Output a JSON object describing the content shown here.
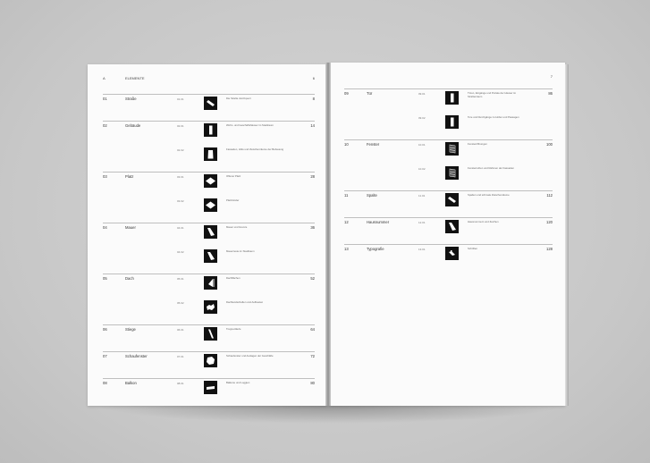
{
  "left_page": {
    "header": {
      "letter": "A",
      "title": "ELEMENTE",
      "page": "6"
    },
    "entries": [
      {
        "num": "01",
        "title": "Straße",
        "page": "8",
        "subs": [
          {
            "code": "01.01",
            "desc": "Die Straße durchquert",
            "icon": "diagonal-bar-icon"
          }
        ]
      },
      {
        "num": "02",
        "title": "Gebäude",
        "page": "14",
        "subs": [
          {
            "code": "02.01",
            "desc": "Wohn- und Geschäftshäuser im Stadtraum",
            "icon": "vertical-block-icon"
          },
          {
            "code": "02.02",
            "desc": "Fassaden, Höfe und Zwischenräume der Bebauung",
            "icon": "tall-block-icon"
          }
        ]
      },
      {
        "num": "03",
        "title": "Platz",
        "page": "28",
        "subs": [
          {
            "code": "03.01",
            "desc": "Offener Platz",
            "icon": "diamond-icon"
          },
          {
            "code": "03.02",
            "desc": "Platzränder",
            "icon": "diamond-icon"
          }
        ]
      },
      {
        "num": "04",
        "title": "Mauer",
        "page": "36",
        "subs": [
          {
            "code": "04.01",
            "desc": "Mauer und Grenze",
            "icon": "wedge-icon"
          },
          {
            "code": "04.02",
            "desc": "Mauerreste im Stadtraum",
            "icon": "wedge-icon"
          }
        ]
      },
      {
        "num": "05",
        "title": "Dach",
        "page": "52",
        "subs": [
          {
            "code": "05.01",
            "desc": "Dachflächen",
            "icon": "triangle-icon"
          },
          {
            "code": "05.02",
            "desc": "Dachlandschaften und Aufbauten",
            "icon": "splash-icon"
          }
        ]
      },
      {
        "num": "06",
        "title": "Stiege",
        "page": "64",
        "subs": [
          {
            "code": "06.01",
            "desc": "Treppenläufe",
            "icon": "steep-bar-icon"
          }
        ]
      },
      {
        "num": "07",
        "title": "Schaufenster",
        "page": "72",
        "subs": [
          {
            "code": "07.01",
            "desc": "Schaufenster und Auslagen der Geschäfte",
            "icon": "hexagon-icon"
          }
        ]
      },
      {
        "num": "08",
        "title": "Balkon",
        "page": "80",
        "subs": [
          {
            "code": "08.01",
            "desc": "Balkone und Loggien",
            "icon": "slab-icon"
          }
        ]
      }
    ]
  },
  "right_page": {
    "header": {
      "page": "7"
    },
    "entries": [
      {
        "num": "09",
        "title": "Tür",
        "page": "86",
        "subs": [
          {
            "code": "09.01",
            "desc": "Türen, Eingänge und Portale der Häuser im Straßenraum",
            "icon": "vertical-block-icon"
          },
          {
            "code": "09.02",
            "desc": "Tore und Durchgänge zu Höfen und Passagen",
            "icon": "vertical-block-icon"
          }
        ]
      },
      {
        "num": "10",
        "title": "Fenster",
        "page": "100",
        "subs": [
          {
            "code": "10.01",
            "desc": "Fensteröffnungen",
            "icon": "lattice-icon"
          },
          {
            "code": "10.02",
            "desc": "Fensterreihen und Rahmen der Fassaden",
            "icon": "lattice-icon"
          }
        ]
      },
      {
        "num": "11",
        "title": "Spalte",
        "page": "112",
        "subs": [
          {
            "code": "11.01",
            "desc": "Spalten und schmale Zwischenräume",
            "icon": "diagonal-bar-icon"
          }
        ]
      },
      {
        "num": "12",
        "title": "Hausnummer",
        "page": "120",
        "subs": [
          {
            "code": "12.01",
            "desc": "Hausnummern und Zeichen",
            "icon": "wedge-icon"
          }
        ]
      },
      {
        "num": "13",
        "title": "Typografie",
        "page": "128",
        "subs": [
          {
            "code": "13.01",
            "desc": "Schriften",
            "icon": "small-bar-icon"
          }
        ]
      }
    ]
  }
}
